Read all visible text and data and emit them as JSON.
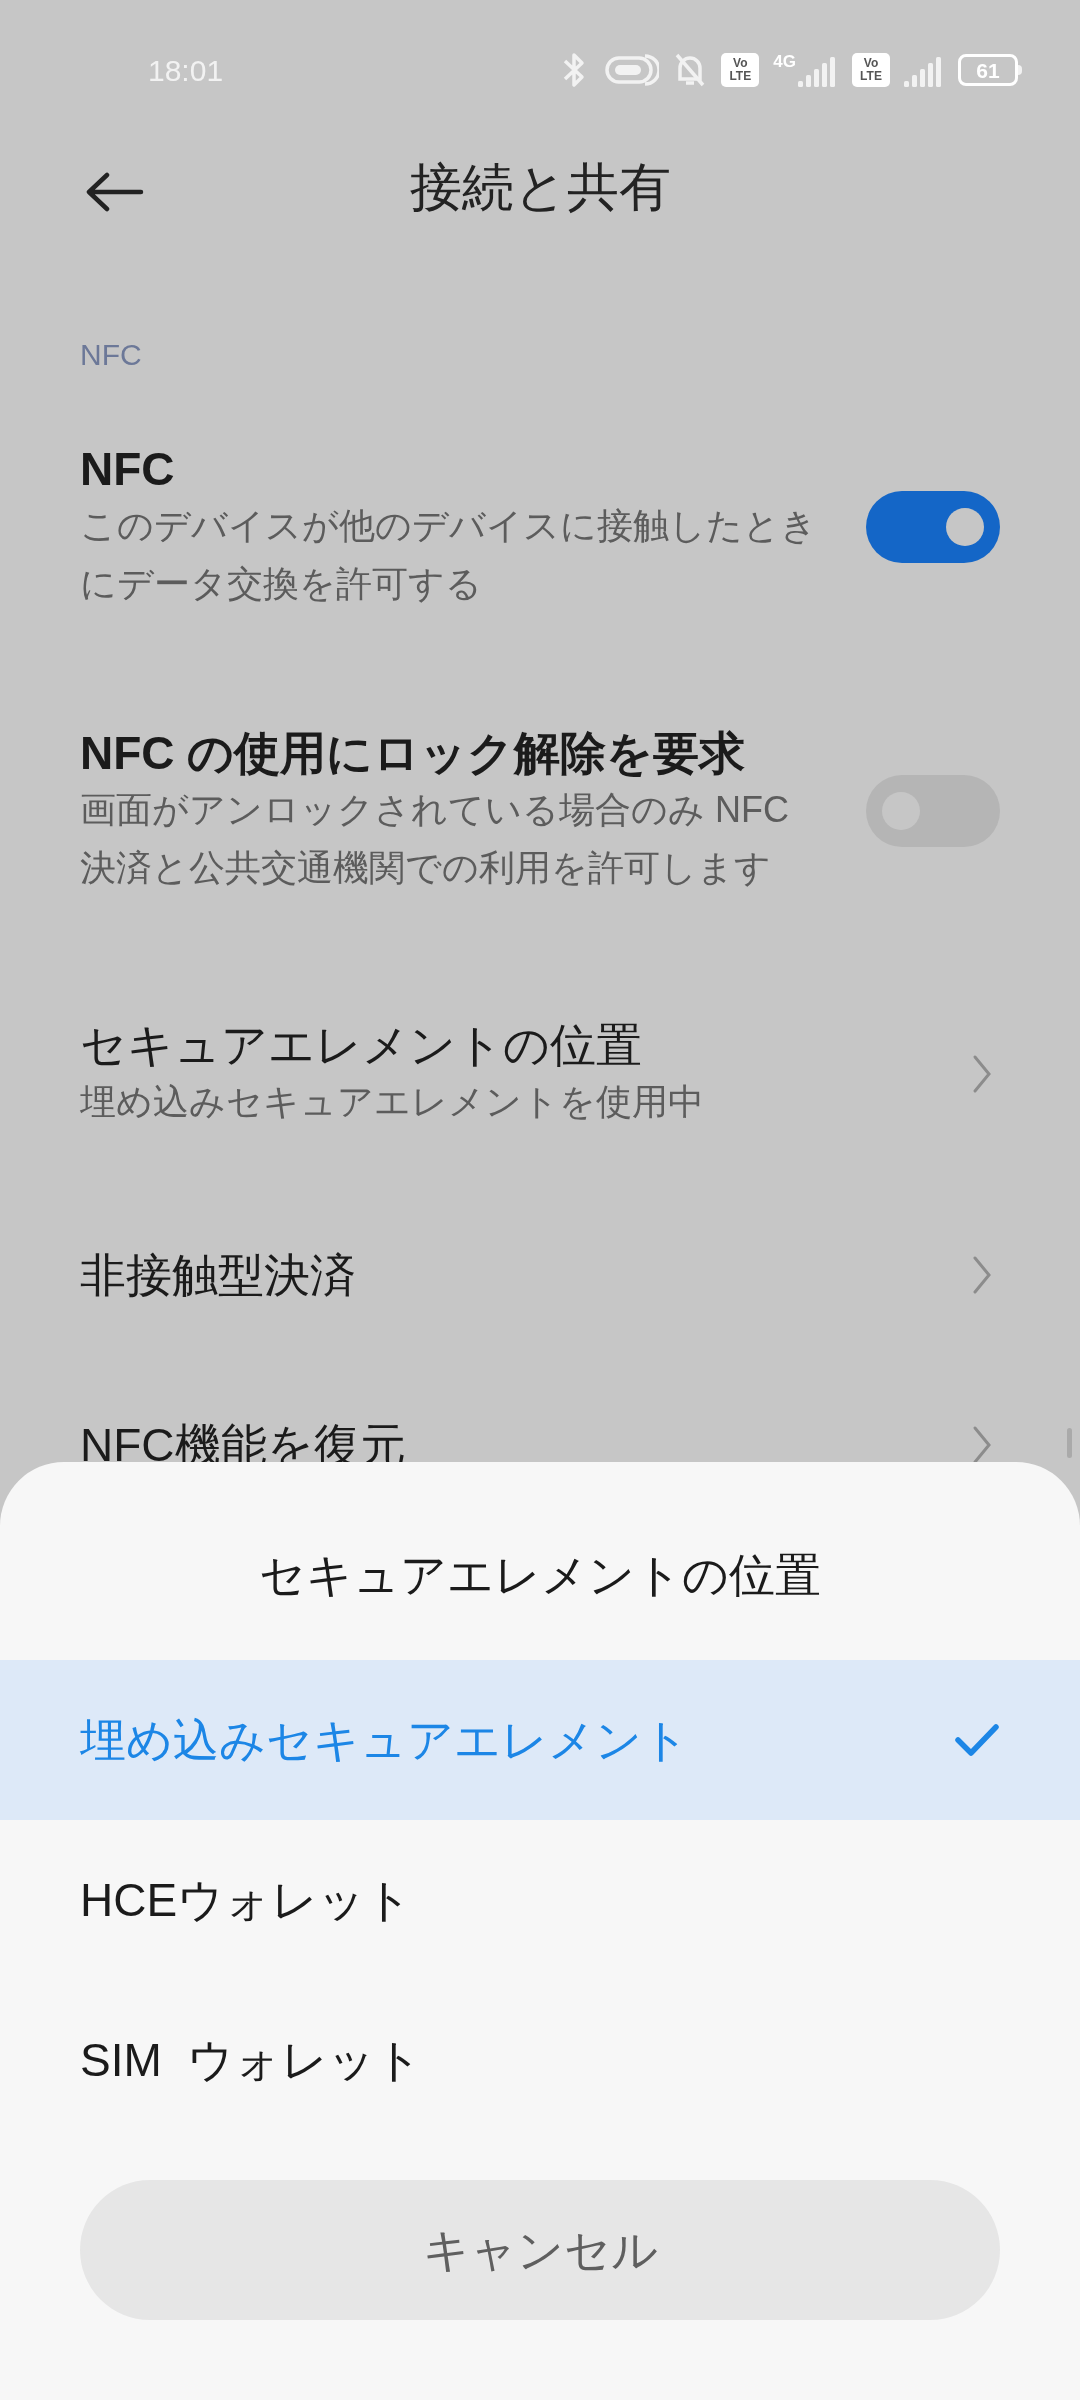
{
  "status_bar": {
    "time": "18:01",
    "network_label": "4G",
    "volte_badges": [
      "Vo LTE",
      "Vo LTE"
    ],
    "battery": "61"
  },
  "header": {
    "title": "接続と共有"
  },
  "section": {
    "label": "NFC"
  },
  "settings": [
    {
      "kind": "toggle",
      "title": "NFC",
      "description": "このデバイスが他のデバイスに接触したときにデータ交換を許可する",
      "on": true
    },
    {
      "kind": "toggle",
      "title": "NFC の使用にロック解除を要求",
      "description": "画面がアンロックされている場合のみ NFC 決済と公共交通機関での利用を許可します",
      "on": false
    },
    {
      "kind": "link",
      "title": "セキュアエレメントの位置",
      "description": "埋め込みセキュアエレメントを使用中"
    },
    {
      "kind": "link",
      "title": "非接触型決済"
    },
    {
      "kind": "link",
      "title": "NFC機能を復元"
    }
  ],
  "sheet": {
    "title": "セキュアエレメントの位置",
    "options": [
      {
        "label": "埋め込みセキュアエレメント",
        "selected": true
      },
      {
        "label": "HCEウォレット",
        "selected": false
      },
      {
        "label": "SIM  ウォレット",
        "selected": false
      }
    ],
    "cancel": "キャンセル"
  }
}
